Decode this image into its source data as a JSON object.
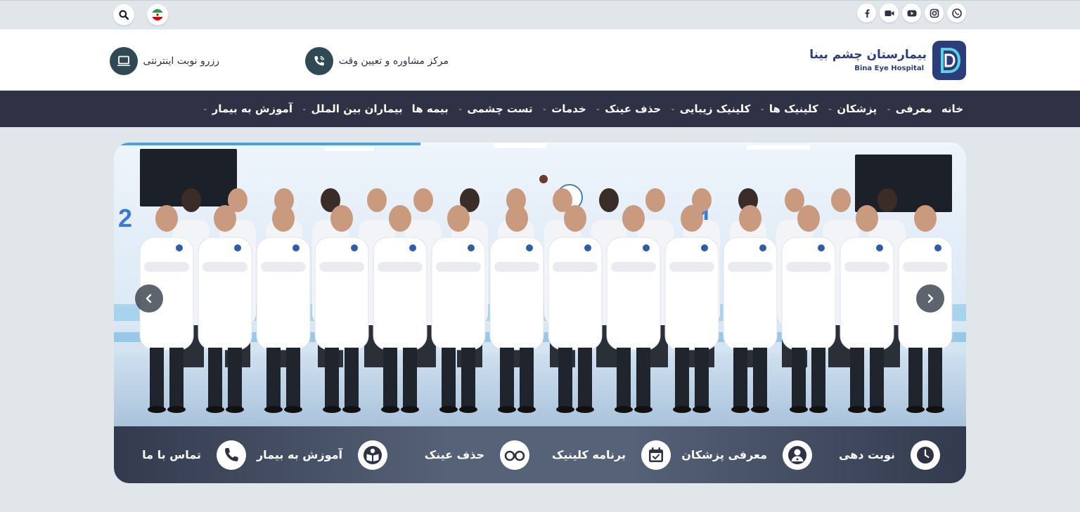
{
  "topbar": {
    "social": [
      "facebook-icon",
      "video-icon",
      "youtube-icon",
      "instagram-icon",
      "whatsapp-icon"
    ],
    "tools": [
      "search-icon",
      "flag-iran-icon"
    ]
  },
  "header": {
    "logo_name": "بیمارستان چشم بینا",
    "logo_en": "Bina Eye Hospital",
    "call_center": "مرکز مشاوره و تعیین وقت",
    "online_booking": "رزرو نوبت اینترنتی"
  },
  "nav": [
    {
      "label": "خانه",
      "dropdown": false
    },
    {
      "label": "معرفی",
      "dropdown": true
    },
    {
      "label": "پزشکان",
      "dropdown": true
    },
    {
      "label": "کلینیک ها",
      "dropdown": true
    },
    {
      "label": "کلینیک زیبایی",
      "dropdown": true
    },
    {
      "label": "حذف عینک",
      "dropdown": true
    },
    {
      "label": "خدمات",
      "dropdown": true
    },
    {
      "label": "تست چشمی",
      "dropdown": true
    },
    {
      "label": "بیمه ها",
      "dropdown": false
    },
    {
      "label": "بیماران بین الملل",
      "dropdown": true
    },
    {
      "label": "آموزش به بیمار",
      "dropdown": true
    }
  ],
  "slider": {
    "progress": 0.36,
    "quick_links": [
      {
        "label": "نوبت دهی",
        "icon": "clock-icon"
      },
      {
        "label": "معرفی پزشکان",
        "icon": "doctor-icon"
      },
      {
        "label": "برنامه کلینیک",
        "icon": "calendar-icon"
      },
      {
        "label": "حذف عینک",
        "icon": "glasses-icon"
      },
      {
        "label": "آموزش به بیمار",
        "icon": "book-reader-icon"
      },
      {
        "label": "تماس با ما",
        "icon": "phone-icon"
      }
    ]
  },
  "colors": {
    "nav_bg": "#2e3244",
    "brand": "#2c3e7a",
    "icon_circle": "#2f4a55",
    "accent": "#4aa3df"
  }
}
